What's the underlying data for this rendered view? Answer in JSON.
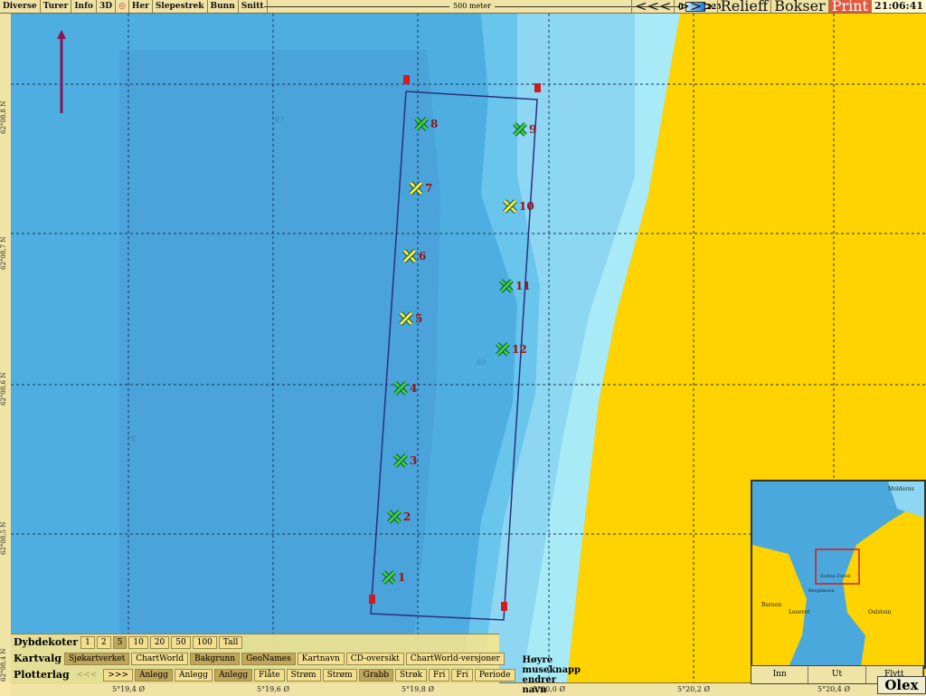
{
  "topbar": {
    "menu": [
      "Diverse",
      "Turer",
      "Info",
      "3D",
      "Her",
      "Slepestrek",
      "Bunn",
      "Snitt"
    ],
    "scale_text": "500 meter",
    "depth_min": "0",
    "depth_max": "225",
    "nav_left": "<<<",
    "nav_right": ">>>",
    "relief": "Relieff",
    "boxes": "Bokser",
    "print": "Print",
    "time": "21:06:41"
  },
  "axes": {
    "lat_labels": [
      "62°08,8 N",
      "62°08,7 N",
      "62°08,6 N",
      "62°08,5 N",
      "62°08,4 N"
    ],
    "lon_labels": [
      "5°19,4 Ø",
      "5°19,6 Ø",
      "5°19,8 Ø",
      "5°20,0 Ø",
      "5°20,2 Ø",
      "5°20,4 Ø"
    ]
  },
  "markers": [
    {
      "n": "1",
      "color": "green"
    },
    {
      "n": "2",
      "color": "green"
    },
    {
      "n": "3",
      "color": "green"
    },
    {
      "n": "4",
      "color": "green"
    },
    {
      "n": "5",
      "color": "yellow"
    },
    {
      "n": "6",
      "color": "yellow"
    },
    {
      "n": "7",
      "color": "yellow"
    },
    {
      "n": "8",
      "color": "green"
    },
    {
      "n": "9",
      "color": "green"
    },
    {
      "n": "10",
      "color": "yellow"
    },
    {
      "n": "11",
      "color": "green"
    },
    {
      "n": "12",
      "color": "green"
    }
  ],
  "depth_labels": [
    "87",
    "60",
    "78"
  ],
  "controls": {
    "depth_contours": {
      "label": "Dybdekoter",
      "values": [
        "1",
        "2",
        "5",
        "10",
        "20",
        "50",
        "100",
        "Tall"
      ]
    },
    "chart_select": {
      "label": "Kartvalg",
      "items": [
        "Sjøkartverket",
        "ChartWorld",
        "Bakgrunn",
        "GeoNames",
        "Kartnavn",
        "CD-oversikt",
        "ChartWorld-versjoner"
      ]
    },
    "plotter": {
      "label": "Plotterlag",
      "items": [
        "<<<",
        ">>>",
        "Anlegg",
        "Anlegg",
        "Anlegg",
        "Flåte",
        "Strøm",
        "Strøm",
        "Grabb",
        "Strøk",
        "Fri",
        "Fri",
        "Periode"
      ],
      "hint": "Høyre museknapp endrer navn"
    }
  },
  "inset": {
    "places": [
      "Molderus",
      "Barnen",
      "Lesevet",
      "Oulstein",
      "Zorten Forelt",
      "Bergsmoen"
    ],
    "buttons": [
      "Inn",
      "Ut",
      "Flytt"
    ]
  },
  "brand": "Olex",
  "colors": {
    "land": "#ffd300",
    "sea_deep": "#4ba8dd",
    "sea_mid": "#69c5ec",
    "sea_shallow": "#a7e8f6",
    "track": "#2b2f7e",
    "marker_green": "#35d64a",
    "marker_yellow": "#f2f04a",
    "label_red": "#9b1010"
  }
}
